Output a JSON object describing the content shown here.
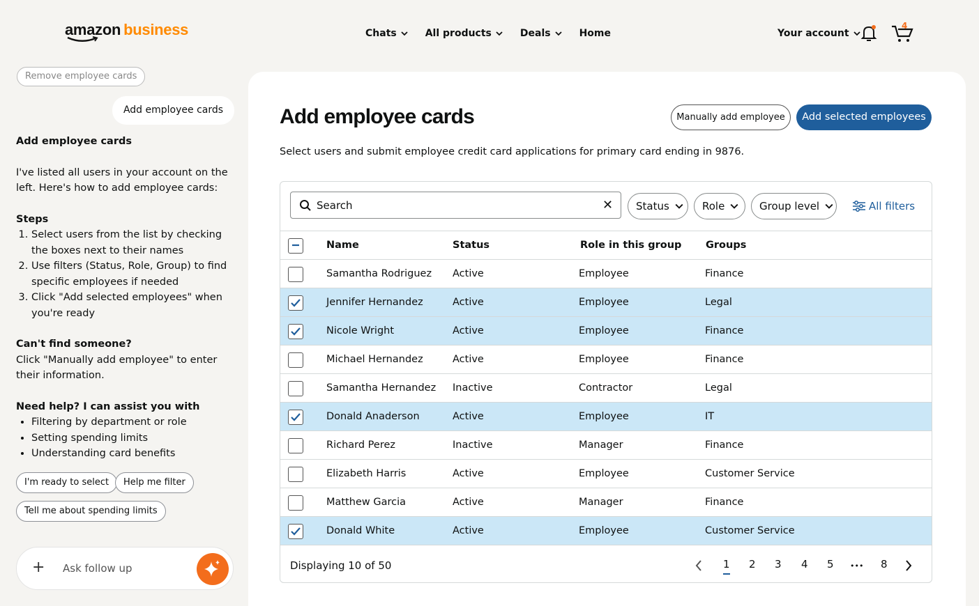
{
  "header": {
    "logo_amazon": "amazon",
    "logo_business": "business",
    "nav": [
      "Chats",
      "All products",
      "Deals",
      "Home"
    ],
    "account": "Your account",
    "cart_count": "4"
  },
  "chat": {
    "prev_chip": "Remove employee cards",
    "user_message": "Add employee cards",
    "heading": "Add employee cards",
    "intro": "I've listed all users in your account on the left. Here's how to add employee cards:",
    "steps_title": "Steps",
    "steps": [
      "Select users from the list by checking the boxes next to their names",
      "Use filters (Status, Role, Group) to find specific employees if needed",
      "Click \"Add selected employees\" when you're ready"
    ],
    "cant_find_title": "Can't find someone?",
    "cant_find_text": "Click \"Manually add employee\" to enter their information.",
    "help_title": "Need help? I can assist you with",
    "help_items": [
      "Filtering by department or role",
      "Setting spending limits",
      "Understanding card benefits"
    ],
    "suggestions": [
      "I'm ready to select",
      "Help me filter",
      "Tell me about spending limits"
    ],
    "followup_placeholder": "Ask follow up"
  },
  "main": {
    "title": "Add employee cards",
    "subtitle": "Select users and submit employee credit card applications for primary card ending in 9876.",
    "manual_button": "Manually add employee",
    "add_button": "Add selected employees",
    "search_value": "Search",
    "filters": [
      "Status",
      "Role",
      "Group level"
    ],
    "all_filters": "All filters",
    "columns": [
      "Name",
      "Status",
      "Role in this group",
      "Groups"
    ],
    "rows": [
      {
        "name": "Samantha Rodriguez",
        "status": "Active",
        "role": "Employee",
        "group": "Finance",
        "selected": false
      },
      {
        "name": "Jennifer Hernandez",
        "status": "Active",
        "role": "Employee",
        "group": "Legal",
        "selected": true
      },
      {
        "name": "Nicole Wright",
        "status": "Active",
        "role": "Employee",
        "group": "Finance",
        "selected": true
      },
      {
        "name": "Michael Hernandez",
        "status": "Active",
        "role": "Employee",
        "group": "Finance",
        "selected": false
      },
      {
        "name": "Samantha Hernandez",
        "status": "Inactive",
        "role": "Contractor",
        "group": "Legal",
        "selected": false
      },
      {
        "name": "Donald Anaderson",
        "status": "Active",
        "role": "Employee",
        "group": "IT",
        "selected": true
      },
      {
        "name": "Richard Perez",
        "status": "Inactive",
        "role": "Manager",
        "group": "Finance",
        "selected": false
      },
      {
        "name": "Elizabeth Harris",
        "status": "Active",
        "role": "Employee",
        "group": "Customer Service",
        "selected": false
      },
      {
        "name": "Matthew Garcia",
        "status": "Active",
        "role": "Manager",
        "group": "Finance",
        "selected": false
      },
      {
        "name": "Donald White",
        "status": "Active",
        "role": "Employee",
        "group": "Customer Service",
        "selected": true
      }
    ],
    "displaying": "Displaying 10 of 50",
    "pages": [
      "1",
      "2",
      "3",
      "4",
      "5",
      "•••",
      "8"
    ],
    "active_page": "1"
  },
  "colors": {
    "accent": "#1f5e9c",
    "selected_row": "#cbe7f7",
    "brand_orange": "#ff8a00",
    "send": "#f36d1c"
  }
}
